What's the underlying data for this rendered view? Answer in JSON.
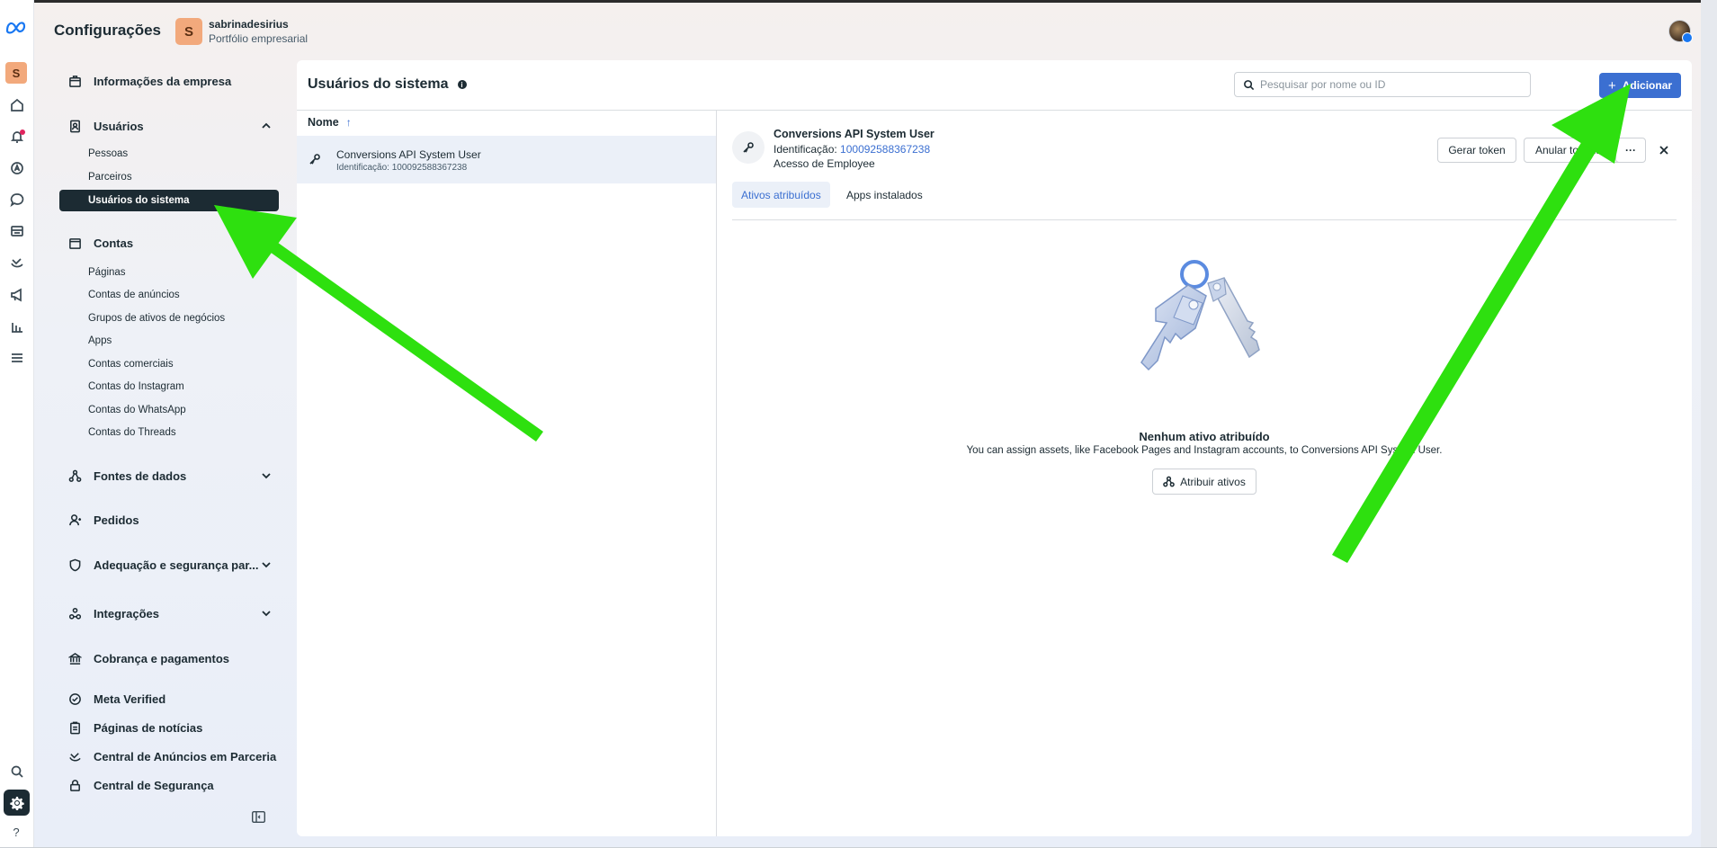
{
  "header": {
    "title": "Configurações",
    "org_initial": "S",
    "org_name": "sabrinadesirius",
    "org_subtitle": "Portfólio empresarial"
  },
  "rail": {
    "org_initial": "S",
    "help": "?"
  },
  "sidebar": {
    "company_info": "Informações da empresa",
    "users": {
      "label": "Usuários",
      "items": [
        "Pessoas",
        "Parceiros",
        "Usuários do sistema"
      ]
    },
    "accounts": {
      "label": "Contas",
      "items": [
        "Páginas",
        "Contas de anúncios",
        "Grupos de ativos de negócios",
        "Apps",
        "Contas comerciais",
        "Contas do Instagram",
        "Contas do WhatsApp",
        "Contas do Threads"
      ]
    },
    "data_sources": "Fontes de dados",
    "requests": "Pedidos",
    "compliance": "Adequação e segurança par...",
    "integrations": "Integrações",
    "billing": "Cobrança e pagamentos",
    "meta_verified": "Meta Verified",
    "news_pages": "Páginas de notícias",
    "partnership_ads": "Central de Anúncios em Parceria",
    "security_center": "Central de Segurança"
  },
  "main": {
    "title": "Usuários do sistema",
    "search_placeholder": "Pesquisar por nome ou ID",
    "add_button": "Adicionar",
    "column_header": "Nome",
    "sort_indicator": "↑",
    "list": [
      {
        "name": "Conversions API System User",
        "id_line": "Identificação: 100092588367238"
      }
    ]
  },
  "detail": {
    "name": "Conversions API System User",
    "id_label": "Identificação: ",
    "id_value": "100092588367238",
    "access": "Acesso de Employee",
    "generate_token": "Gerar token",
    "revoke_token": "Anular tokens",
    "more": "···",
    "tabs": [
      "Ativos atribuídos",
      "Apps instalados"
    ],
    "empty_title": "Nenhum ativo atribuído",
    "empty_desc": "You can assign assets, like Facebook Pages and Instagram accounts, to Conversions API System User.",
    "assign_button": "Atribuir ativos"
  },
  "colors": {
    "accent": "#3b6fd1",
    "nav_active": "#1c2b33",
    "org_avatar": "#f2a97c",
    "annotation_arrow": "#2ee00f"
  }
}
